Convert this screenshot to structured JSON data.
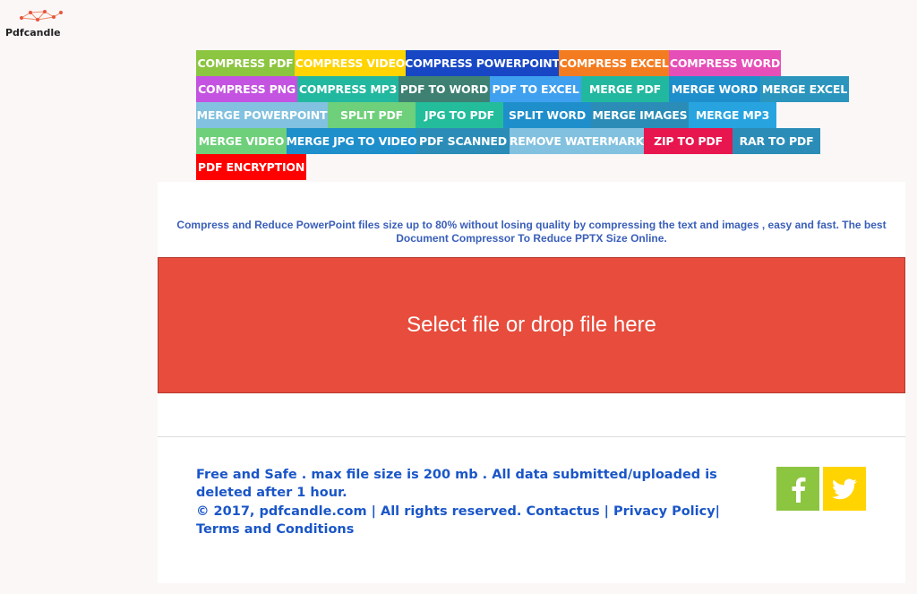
{
  "logo": {
    "text": "Pdfcandle"
  },
  "tools": {
    "rows": [
      [
        {
          "label": "COMPRESS PDF",
          "color": "#8cc540",
          "w": 110
        },
        {
          "label": "COMPRESS VIDEO",
          "color": "#ffd400",
          "w": 124
        },
        {
          "label": "COMPRESS POWERPOINT",
          "color": "#1747c4",
          "w": 171
        },
        {
          "label": "COMPRESS EXCEL",
          "color": "#f47c20",
          "w": 123
        },
        {
          "label": "COMPRESS WORD",
          "color": "#e64fb7",
          "w": 125
        }
      ],
      [
        {
          "label": "COMPRESS PNG",
          "color": "#c353e0",
          "w": 113
        },
        {
          "label": "COMPRESS MP3",
          "color": "#22b8a0",
          "w": 113
        },
        {
          "label": "PDF TO WORD",
          "color": "#3e8173",
          "w": 102
        },
        {
          "label": "PDF TO EXCEL",
          "color": "#3fa0f0",
          "w": 102
        },
        {
          "label": "MERGE PDF",
          "color": "#22b8a0",
          "w": 98
        },
        {
          "label": "MERGE WORD",
          "color": "#1f8fcb",
          "w": 102
        },
        {
          "label": "MERGE EXCEL",
          "color": "#2b95bd",
          "w": 99
        }
      ],
      [
        {
          "label": "MERGE POWERPOINT",
          "color": "#82c1df",
          "w": 147
        },
        {
          "label": "SPLIT PDF",
          "color": "#6ed07a",
          "w": 98
        },
        {
          "label": "JPG TO PDF",
          "color": "#23bd9c",
          "w": 98
        },
        {
          "label": "SPLIT WORD",
          "color": "#1f8fcb",
          "w": 98
        },
        {
          "label": "MERGE IMAGES",
          "color": "#2b8db7",
          "w": 109
        },
        {
          "label": "MERGE MP3",
          "color": "#27a4e0",
          "w": 98
        }
      ],
      [
        {
          "label": "MERGE VIDEO",
          "color": "#6ed07a",
          "w": 101
        },
        {
          "label": "MERGE JPG TO VIDEO",
          "color": "#1f8fcb",
          "w": 145
        },
        {
          "label": "PDF SCANNED",
          "color": "#2b8db7",
          "w": 104
        },
        {
          "label": "REMOVE WATERMARK",
          "color": "#82c1df",
          "w": 150
        },
        {
          "label": "ZIP TO PDF",
          "color": "#e8164f",
          "w": 99
        },
        {
          "label": "RAR TO PDF",
          "color": "#2b8db7",
          "w": 98
        }
      ],
      [
        {
          "label": "PDF ENCRYPTION",
          "color": "#ff0000",
          "w": 123
        }
      ]
    ]
  },
  "main": {
    "description": "Compress and Reduce PowerPoint files size up to 80% without losing quality by compressing the text and images , easy and fast. The best Document Compressor To Reduce PPTX Size Online.",
    "drop_label": "Select file or drop file here",
    "drop_color": "#e74c3c"
  },
  "footer": {
    "notice": "Free and Safe . max file size is 200 mb . All data submitted/uploaded is deleted after 1 hour.",
    "copyright": "© 2017, pdfcandle.com | All rights reserved.",
    "contact": "Contactus",
    "sep1": " | ",
    "privacy": "Privacy Policy",
    "sep2": "| ",
    "terms": "Terms and Conditions"
  },
  "social": {
    "facebook_icon": "facebook-icon",
    "twitter_icon": "twitter-icon",
    "facebook_color": "#8cc540",
    "twitter_color": "#ffd400"
  }
}
